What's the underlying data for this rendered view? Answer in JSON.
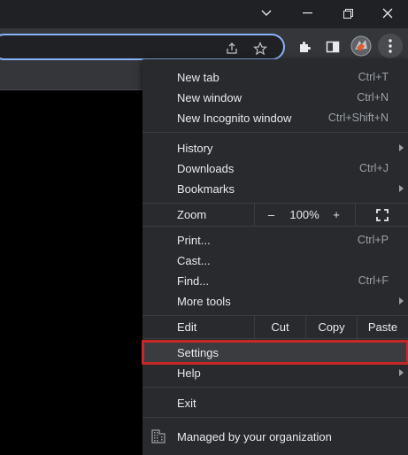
{
  "window_controls": {
    "tab_search": "⌄",
    "minimize": "—",
    "restore": "❐",
    "close": "✕"
  },
  "menu": {
    "group1": [
      {
        "label": "New tab",
        "shortcut": "Ctrl+T"
      },
      {
        "label": "New window",
        "shortcut": "Ctrl+N"
      },
      {
        "label": "New Incognito window",
        "shortcut": "Ctrl+Shift+N"
      }
    ],
    "group2": [
      {
        "label": "History",
        "shortcut": ""
      },
      {
        "label": "Downloads",
        "shortcut": "Ctrl+J"
      },
      {
        "label": "Bookmarks",
        "shortcut": ""
      }
    ],
    "zoom": {
      "label": "Zoom",
      "minus": "–",
      "value": "100%",
      "plus": "+"
    },
    "group3": [
      {
        "label": "Print...",
        "shortcut": "Ctrl+P"
      },
      {
        "label": "Cast...",
        "shortcut": ""
      },
      {
        "label": "Find...",
        "shortcut": "Ctrl+F"
      },
      {
        "label": "More tools",
        "shortcut": ""
      }
    ],
    "edit": {
      "label": "Edit",
      "cut": "Cut",
      "copy": "Copy",
      "paste": "Paste"
    },
    "settings": {
      "label": "Settings"
    },
    "help": {
      "label": "Help"
    },
    "exit": {
      "label": "Exit"
    },
    "managed": {
      "label": "Managed by your organization"
    }
  },
  "colors": {
    "menu_bg": "#292a2d",
    "highlight_border": "#c62828",
    "omnibox_focus": "#8ab4f8"
  }
}
